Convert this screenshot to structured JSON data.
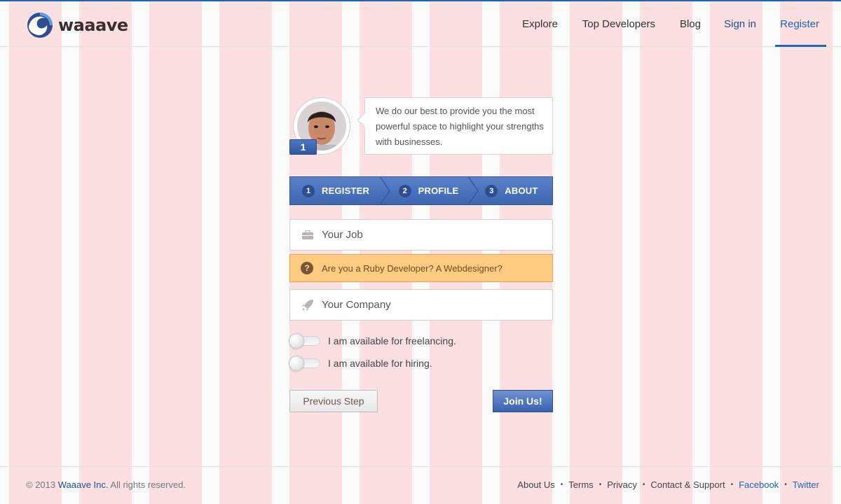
{
  "brand": {
    "name": "waaave",
    "logo_icon": "wave-logo-icon"
  },
  "nav": {
    "items": [
      {
        "label": "Explore"
      },
      {
        "label": "Top Developers"
      },
      {
        "label": "Blog"
      },
      {
        "label": "Sign in"
      },
      {
        "label": "Register",
        "active": true
      }
    ]
  },
  "intro": {
    "avatar_badge": "1",
    "message": "We do our best to provide you the most powerful space to highlight your strengths with businesses."
  },
  "steps": [
    {
      "number": "1",
      "label": "REGISTER"
    },
    {
      "number": "2",
      "label": "PROFILE"
    },
    {
      "number": "3",
      "label": "ABOUT"
    }
  ],
  "form": {
    "job": {
      "placeholder": "Your Job",
      "value": "",
      "icon": "briefcase-icon"
    },
    "hint": {
      "icon": "question-icon",
      "text": "Are you a Ruby Developer? A Webdesigner?"
    },
    "company": {
      "placeholder": "Your Company",
      "value": "",
      "icon": "rocket-icon"
    },
    "toggles": [
      {
        "label": "I am available for freelancing.",
        "on": false
      },
      {
        "label": "I am available for hiring.",
        "on": false
      }
    ],
    "prev_label": "Previous Step",
    "submit_label": "Join Us!"
  },
  "footer": {
    "copyright_prefix": "© 2013 ",
    "copyright_brand": "Waaave Inc.",
    "copyright_suffix": " All rights reserved.",
    "links": [
      "About Us",
      "Terms",
      "Privacy",
      "Contact & Support",
      "Facebook",
      "Twitter"
    ]
  },
  "colors": {
    "accent": "#1a67b5",
    "steps_bar": "#4a71bb",
    "hint_background": "#ffcb80",
    "grid_overlay": "#ffb4b9"
  }
}
